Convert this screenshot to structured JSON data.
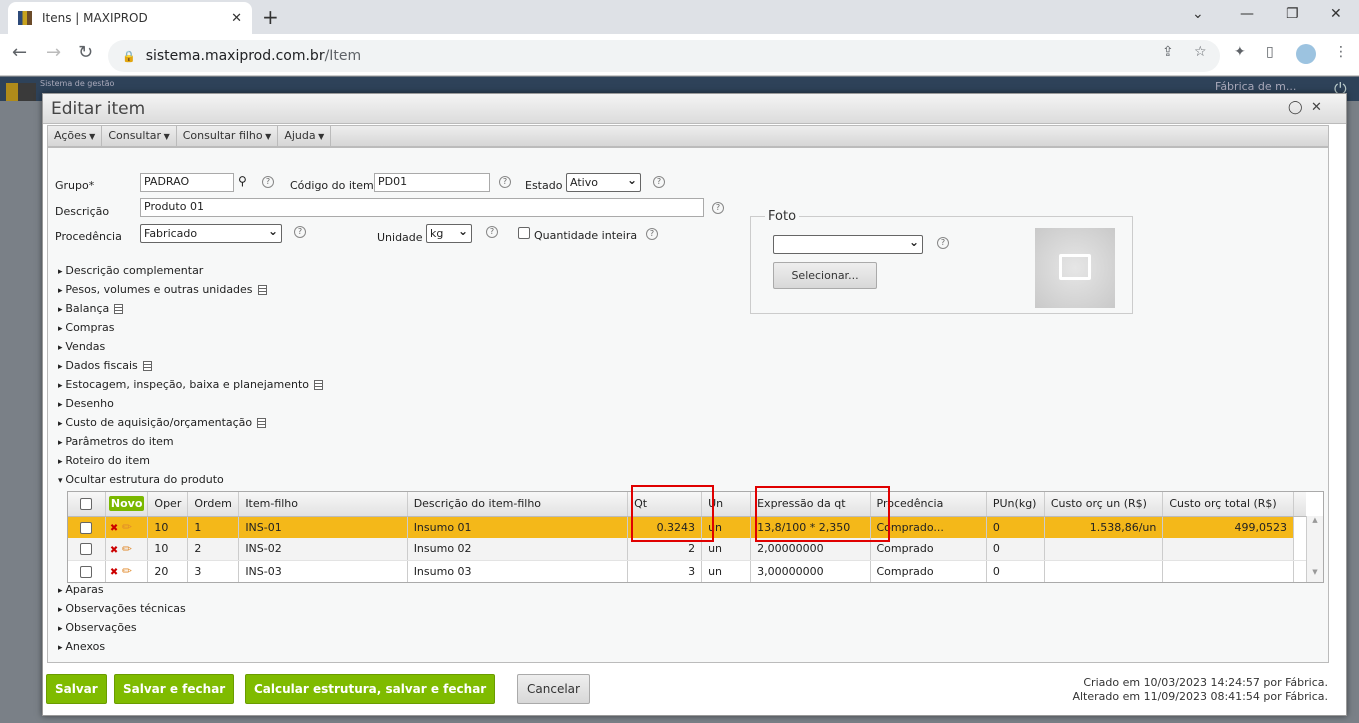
{
  "browser": {
    "tab_title": "Itens | MAXIPROD",
    "url_host": "sistema.maxiprod.com.br",
    "url_path": "/Item"
  },
  "app": {
    "system_label": "Sistema de gestão",
    "user": "Fábrica de m..."
  },
  "dialog": {
    "title": "Editar item",
    "menu": [
      "Ações",
      "Consultar",
      "Consultar filho",
      "Ajuda"
    ],
    "form": {
      "grupo_label": "Grupo*",
      "grupo_value": "PADRAO",
      "codigo_label": "Código do item",
      "codigo_value": "PD01",
      "estado_label": "Estado",
      "estado_value": "Ativo",
      "descricao_label": "Descrição",
      "descricao_value": "Produto 01",
      "procedencia_label": "Procedência",
      "procedencia_value": "Fabricado",
      "unidade_label": "Unidade",
      "unidade_value": "kg",
      "qtd_inteira_label": "Quantidade inteira",
      "help": "?"
    },
    "foto": {
      "legend": "Foto",
      "select_value": "",
      "select_button": "Selecionar..."
    },
    "sections_top": [
      {
        "label": "Descrição complementar",
        "doc": false
      },
      {
        "label": "Pesos, volumes e outras unidades",
        "doc": true
      },
      {
        "label": "Balança",
        "doc": true
      },
      {
        "label": "Compras",
        "doc": false
      },
      {
        "label": "Vendas",
        "doc": false
      },
      {
        "label": "Dados fiscais",
        "doc": true
      },
      {
        "label": "Estocagem, inspeção, baixa e planejamento",
        "doc": true
      },
      {
        "label": "Desenho",
        "doc": false
      },
      {
        "label": "Custo de aquisição/orçamentação",
        "doc": true
      },
      {
        "label": "Parâmetros do item",
        "doc": false
      },
      {
        "label": "Roteiro do item",
        "doc": false
      },
      {
        "label": "Ocultar estrutura do produto",
        "doc": false
      }
    ],
    "grid": {
      "novo": "Novo",
      "columns": [
        "Oper",
        "Ordem",
        "Item-filho",
        "Descrição do item-filho",
        "Qt",
        "Un",
        "Expressão da qt",
        "Procedência",
        "PUn(kg)",
        "Custo orç un (R$)",
        "Custo orç total (R$)"
      ],
      "rows": [
        [
          "10",
          "1",
          "INS-01",
          "Insumo 01",
          "0.3243",
          "un",
          "13,8/100 * 2,350",
          "Comprado...",
          "0",
          "1.538,86/un",
          "499,0523"
        ],
        [
          "10",
          "2",
          "INS-02",
          "Insumo 02",
          "2",
          "un",
          "2,00000000",
          "Comprado",
          "0",
          "",
          ""
        ],
        [
          "20",
          "3",
          "INS-03",
          "Insumo 03",
          "3",
          "un",
          "3,00000000",
          "Comprado",
          "0",
          "",
          ""
        ]
      ]
    },
    "sections_bottom": [
      "Aparas",
      "Observações técnicas",
      "Observações",
      "Anexos"
    ],
    "buttons": {
      "salvar": "Salvar",
      "salvar_fechar": "Salvar e fechar",
      "calcular": "Calcular estrutura, salvar e fechar",
      "cancelar": "Cancelar"
    },
    "meta": {
      "criado": "Criado em 10/03/2023 14:24:57 por Fábrica.",
      "alterado": "Alterado em 11/09/2023 08:41:54 por Fábrica."
    }
  },
  "colors": {
    "highlight": "#f4b819",
    "green": "#7fbb00",
    "annotation": "#e00000"
  }
}
